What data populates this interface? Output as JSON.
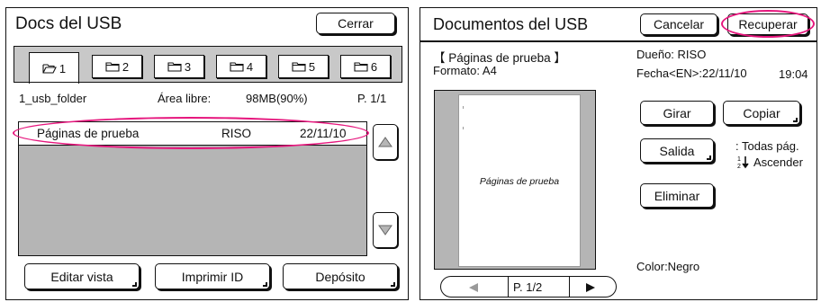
{
  "left": {
    "title": "Docs del USB",
    "close_label": "Cerrar",
    "tabs": [
      {
        "label": "1",
        "active": true
      },
      {
        "label": "2",
        "active": false
      },
      {
        "label": "3",
        "active": false
      },
      {
        "label": "4",
        "active": false
      },
      {
        "label": "5",
        "active": false
      },
      {
        "label": "6",
        "active": false
      }
    ],
    "folder_name": "1_usb_folder",
    "free_area_label": "Área libre:",
    "free_area_value": "98MB(90%)",
    "page": "P. 1/1",
    "list": [
      {
        "name": "Páginas de prueba",
        "owner": "RISO",
        "date": "22/11/10"
      }
    ],
    "buttons": {
      "edit_view": "Editar vista",
      "print_id": "Imprimir ID",
      "deposit": "Depósito"
    }
  },
  "right": {
    "title": "Documentos del USB",
    "cancel_label": "Cancelar",
    "recover_label": "Recuperar",
    "doc_name": "【 Páginas de prueba 】",
    "format": "Formato: A4",
    "owner": "Dueño: RISO",
    "date_label": "Fecha<EN>:22/11/10",
    "time": "19:04",
    "preview_text": "Páginas de prueba",
    "buttons": {
      "rotate": "Girar",
      "copy": "Copiar",
      "output": "Salida",
      "delete": "Eliminar"
    },
    "output_pages": ": Todas pág.",
    "output_order": "Ascender",
    "color": "Color:Negro",
    "page": "P. 1/2"
  },
  "colors": {
    "highlight": "#e6167d",
    "panel_fill": "#b5b5b5",
    "tab_strip": "#c8c8c8"
  }
}
